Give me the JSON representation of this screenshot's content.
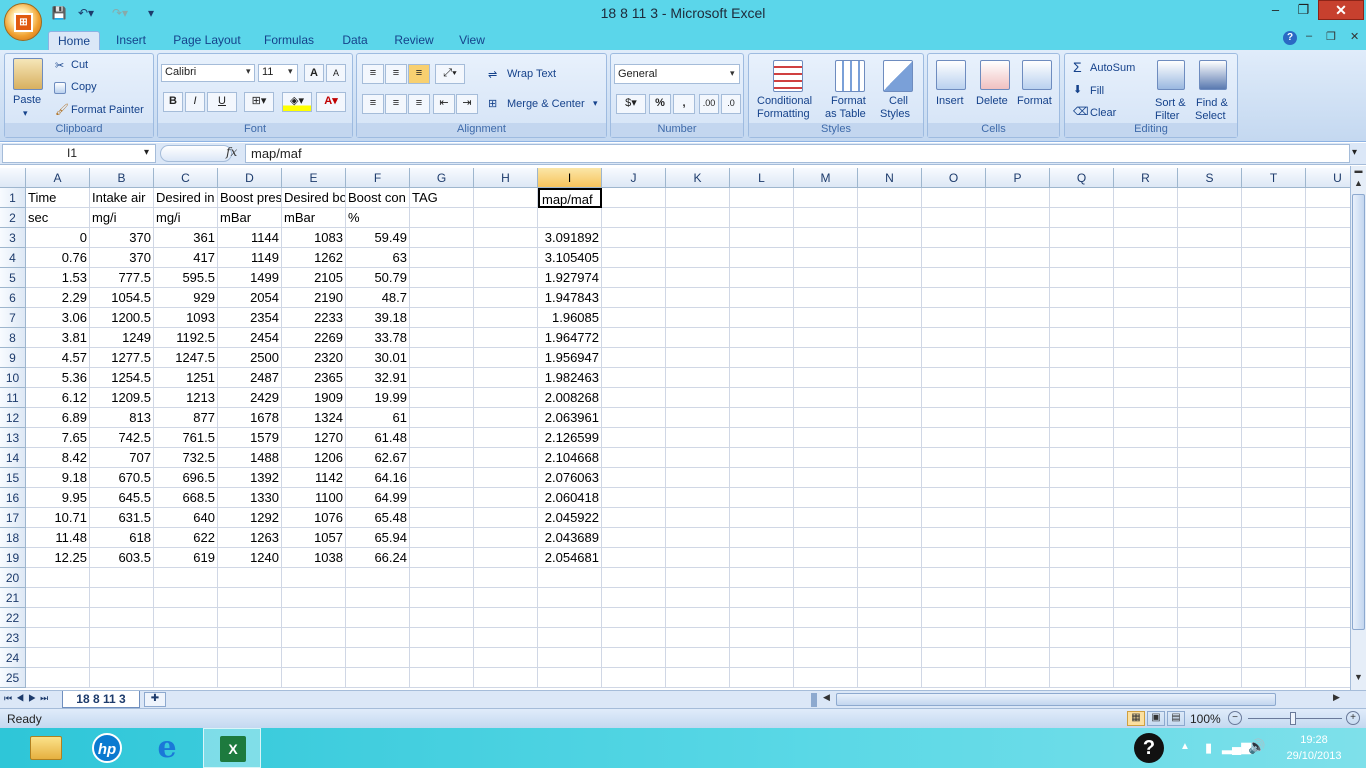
{
  "window": {
    "title": "18 8 11 3 - Microsoft Excel"
  },
  "ribbon_tabs": [
    "Home",
    "Insert",
    "Page Layout",
    "Formulas",
    "Data",
    "Review",
    "View"
  ],
  "clipboard": {
    "paste": "Paste",
    "cut": "Cut",
    "copy": "Copy",
    "format_painter": "Format Painter",
    "label": "Clipboard"
  },
  "font": {
    "name": "Calibri",
    "size": "11",
    "label": "Font",
    "bold": "B",
    "italic": "I",
    "underline": "U",
    "grow": "A",
    "shrink": "A"
  },
  "alignment": {
    "wrap": "Wrap Text",
    "merge": "Merge & Center",
    "label": "Alignment"
  },
  "number": {
    "format": "General",
    "label": "Number",
    "percent": "%",
    "comma": ",",
    "inc_decimal": ".00",
    "dec_decimal": ".0"
  },
  "styles": {
    "conditional_1": "Conditional",
    "conditional_2": "Formatting",
    "format_table_1": "Format",
    "format_table_2": "as Table",
    "cell_styles_1": "Cell",
    "cell_styles_2": "Styles",
    "label": "Styles"
  },
  "cells": {
    "insert": "Insert",
    "delete": "Delete",
    "format": "Format",
    "label": "Cells"
  },
  "editing": {
    "autosum": "AutoSum",
    "fill": "Fill",
    "clear": "Clear",
    "sort_1": "Sort &",
    "sort_2": "Filter",
    "find_1": "Find &",
    "find_2": "Select",
    "label": "Editing",
    "sigma": "Σ"
  },
  "formula_bar": {
    "name_box": "I1",
    "fx": "fx",
    "content": "map/maf"
  },
  "columns": [
    "A",
    "B",
    "C",
    "D",
    "E",
    "F",
    "G",
    "H",
    "I",
    "J",
    "K",
    "L",
    "M",
    "N",
    "O",
    "P",
    "Q",
    "R",
    "S",
    "T",
    "U"
  ],
  "rows": [
    [
      "Time",
      "Intake air",
      "Desired in",
      "Boost pres",
      "Desired bo",
      "Boost con",
      "TAG",
      "",
      "map/maf"
    ],
    [
      "sec",
      "mg/i",
      "mg/i",
      "mBar",
      "mBar",
      "%",
      "",
      "",
      ""
    ],
    [
      "0",
      "370",
      "361",
      "1144",
      "1083",
      "59.49",
      "",
      "",
      "3.091892"
    ],
    [
      "0.76",
      "370",
      "417",
      "1149",
      "1262",
      "63",
      "",
      "",
      "3.105405"
    ],
    [
      "1.53",
      "777.5",
      "595.5",
      "1499",
      "2105",
      "50.79",
      "",
      "",
      "1.927974"
    ],
    [
      "2.29",
      "1054.5",
      "929",
      "2054",
      "2190",
      "48.7",
      "",
      "",
      "1.947843"
    ],
    [
      "3.06",
      "1200.5",
      "1093",
      "2354",
      "2233",
      "39.18",
      "",
      "",
      "1.96085"
    ],
    [
      "3.81",
      "1249",
      "1192.5",
      "2454",
      "2269",
      "33.78",
      "",
      "",
      "1.964772"
    ],
    [
      "4.57",
      "1277.5",
      "1247.5",
      "2500",
      "2320",
      "30.01",
      "",
      "",
      "1.956947"
    ],
    [
      "5.36",
      "1254.5",
      "1251",
      "2487",
      "2365",
      "32.91",
      "",
      "",
      "1.982463"
    ],
    [
      "6.12",
      "1209.5",
      "1213",
      "2429",
      "1909",
      "19.99",
      "",
      "",
      "2.008268"
    ],
    [
      "6.89",
      "813",
      "877",
      "1678",
      "1324",
      "61",
      "",
      "",
      "2.063961"
    ],
    [
      "7.65",
      "742.5",
      "761.5",
      "1579",
      "1270",
      "61.48",
      "",
      "",
      "2.126599"
    ],
    [
      "8.42",
      "707",
      "732.5",
      "1488",
      "1206",
      "62.67",
      "",
      "",
      "2.104668"
    ],
    [
      "9.18",
      "670.5",
      "696.5",
      "1392",
      "1142",
      "64.16",
      "",
      "",
      "2.076063"
    ],
    [
      "9.95",
      "645.5",
      "668.5",
      "1330",
      "1100",
      "64.99",
      "",
      "",
      "2.060418"
    ],
    [
      "10.71",
      "631.5",
      "640",
      "1292",
      "1076",
      "65.48",
      "",
      "",
      "2.045922"
    ],
    [
      "11.48",
      "618",
      "622",
      "1263",
      "1057",
      "65.94",
      "",
      "",
      "2.043689"
    ],
    [
      "12.25",
      "603.5",
      "619",
      "1240",
      "1038",
      "66.24",
      "",
      "",
      "2.054681"
    ]
  ],
  "total_rows": 25,
  "sheet_tab": "18 8 11 3",
  "status": {
    "ready": "Ready",
    "zoom": "100%"
  },
  "taskbar": {
    "time": "19:28",
    "date": "29/10/2013"
  }
}
